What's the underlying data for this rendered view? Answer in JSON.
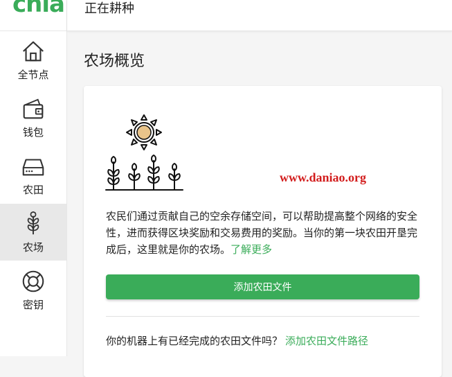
{
  "app": {
    "logo_text": "chia"
  },
  "header": {
    "title": "正在耕种"
  },
  "sidebar": {
    "items": [
      {
        "label": "全节点",
        "icon": "home-icon",
        "active": false
      },
      {
        "label": "钱包",
        "icon": "wallet-icon",
        "active": false
      },
      {
        "label": "农田",
        "icon": "storage-icon",
        "active": false
      },
      {
        "label": "农场",
        "icon": "plant-icon",
        "active": true
      },
      {
        "label": "密钥",
        "icon": "lifebuoy-icon",
        "active": false
      }
    ]
  },
  "main": {
    "page_title": "农场概览",
    "watermark": "www.daniao.org",
    "description": "农民们通过贡献自己的空余存储空间，可以帮助提高整个网络的安全性，进而获得区块奖励和交易费用的奖励。当你的第一块农田开垦完成后，这里就是你的农场。",
    "learn_more": "了解更多",
    "add_plot_button": "添加农田文件",
    "question": "你的机器上有已经完成的农田文件吗？",
    "add_plot_dir_link": "添加农田文件路径"
  },
  "colors": {
    "accent": "#3aac59",
    "watermark": "#d21c1c"
  }
}
